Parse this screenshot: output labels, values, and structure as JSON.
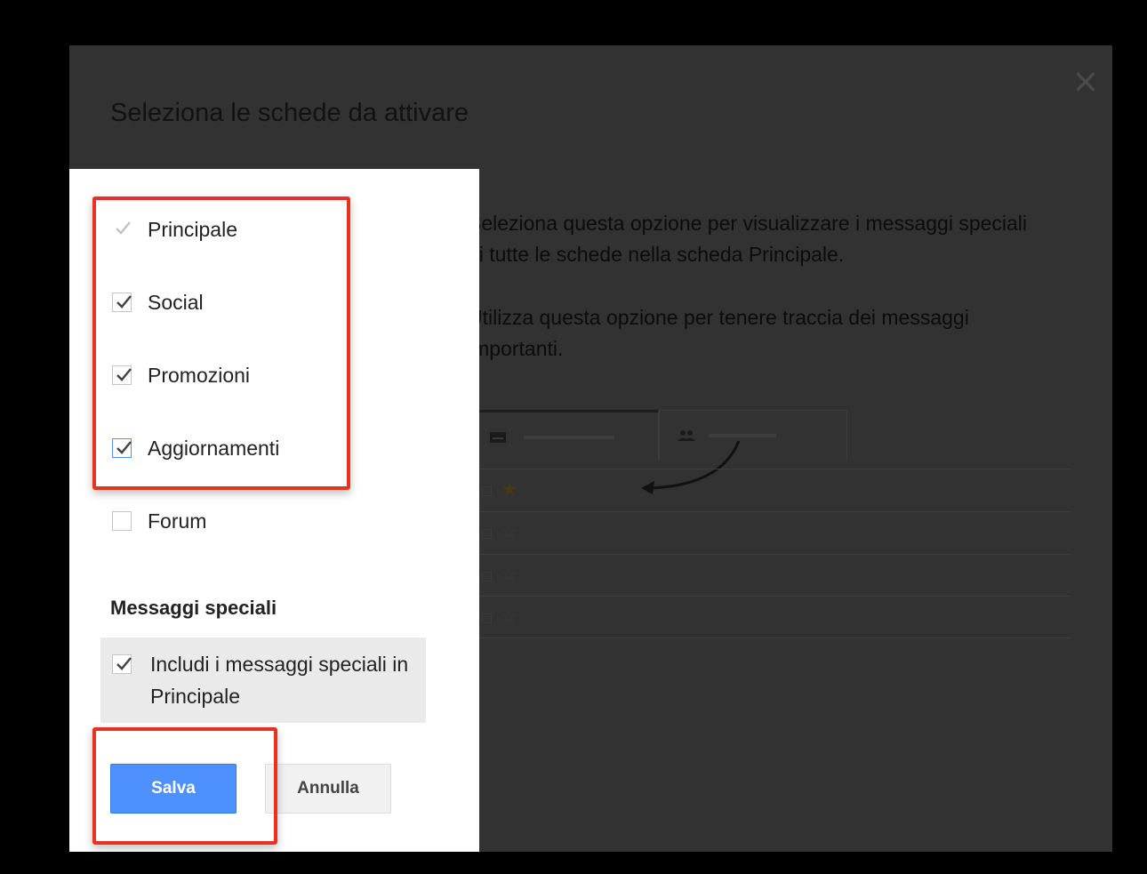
{
  "dialog": {
    "title": "Seleziona le schede da attivare",
    "close_icon": "close-icon"
  },
  "tabs": [
    {
      "label": "Principale",
      "checked": true,
      "disabled": true
    },
    {
      "label": "Social",
      "checked": true
    },
    {
      "label": "Promozioni",
      "checked": true
    },
    {
      "label": "Aggiornamenti",
      "checked": true,
      "focused": true
    },
    {
      "label": "Forum",
      "checked": false
    }
  ],
  "special": {
    "heading": "Messaggi speciali",
    "option_label": "Includi i messaggi speciali in Principale",
    "checked": true
  },
  "buttons": {
    "save": "Salva",
    "cancel": "Annulla"
  },
  "description": {
    "line1": "Seleziona questa opzione per visualizzare i messaggi speciali di tutte le schede nella scheda Principale.",
    "line2": "Utilizza questa opzione per tenere traccia dei messaggi importanti."
  },
  "preview": {
    "tab_icons": [
      "inbox-icon",
      "people-icon"
    ],
    "rows": [
      {
        "starred": true
      },
      {
        "starred": false
      },
      {
        "starred": false
      },
      {
        "starred": false
      }
    ]
  },
  "colors": {
    "accent": "#4d90fe",
    "highlight": "#e8321f",
    "overlay": "#323232"
  }
}
